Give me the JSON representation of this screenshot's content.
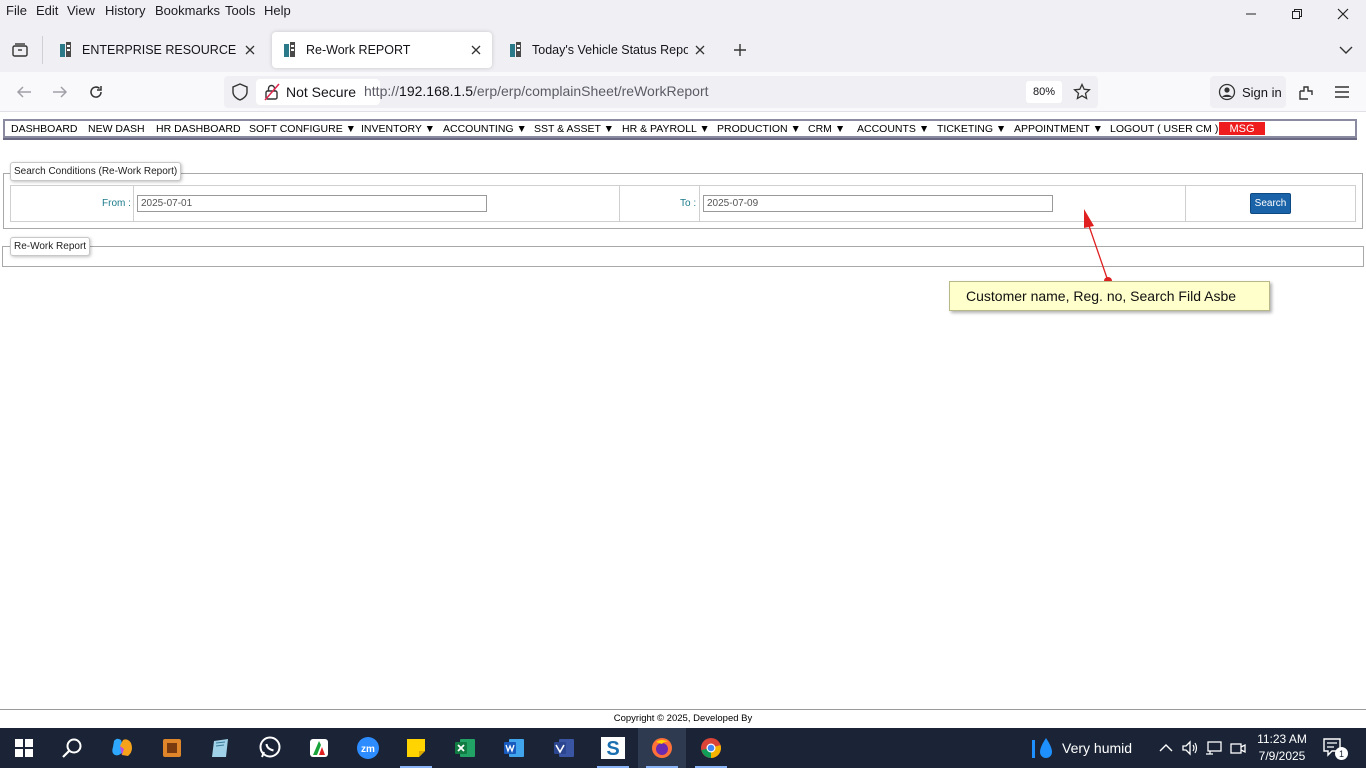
{
  "menubar": {
    "items": [
      "File",
      "Edit",
      "View",
      "History",
      "Bookmarks",
      "Tools",
      "Help"
    ]
  },
  "tabs": [
    {
      "label": "ENTERPRISE RESOURCE PLANN",
      "active": false
    },
    {
      "label": "Re-Work REPORT",
      "active": true
    },
    {
      "label": "Today's Vehicle Status Report",
      "active": false
    }
  ],
  "navbar": {
    "security_label": "Not Secure",
    "url_prefix": "http://",
    "url_host": "192.168.1.5",
    "url_path": "/erp/erp/complainSheet/reWorkReport",
    "zoom": "80%",
    "signin_label": "Sign in"
  },
  "app_menu": {
    "items": [
      "DASHBOARD",
      "NEW DASH",
      "HR DASHBOARD",
      "SOFT CONFIGURE ▼",
      "INVENTORY ▼",
      "ACCOUNTING ▼",
      "SST & ASSET ▼",
      "HR & PAYROLL ▼",
      "PRODUCTION ▼",
      "CRM ▼",
      "ACCOUNTS ▼",
      "TICKETING ▼",
      "APPOINTMENT ▼",
      "LOGOUT ( USER CM )"
    ],
    "msg_label": "MSG",
    "msg_color": "#ee1c1c"
  },
  "search": {
    "legend": "Search Conditions (Re-Work Report)",
    "from_label": "From :",
    "from_value": "2025-07-01",
    "to_label": "To :",
    "to_value": "2025-07-09",
    "button_label": "Search",
    "button_color": "#1b63a8"
  },
  "report": {
    "legend": "Re-Work Report"
  },
  "annotation": {
    "text": "Customer name, Reg. no, Search Fild Asbe",
    "arrow_color": "#e02020"
  },
  "footer": {
    "text": "Copyright © 2025, Developed By"
  },
  "taskbar": {
    "weather": "Very humid",
    "time": "11:23 AM",
    "date": "7/9/2025",
    "notification_count": "1"
  }
}
